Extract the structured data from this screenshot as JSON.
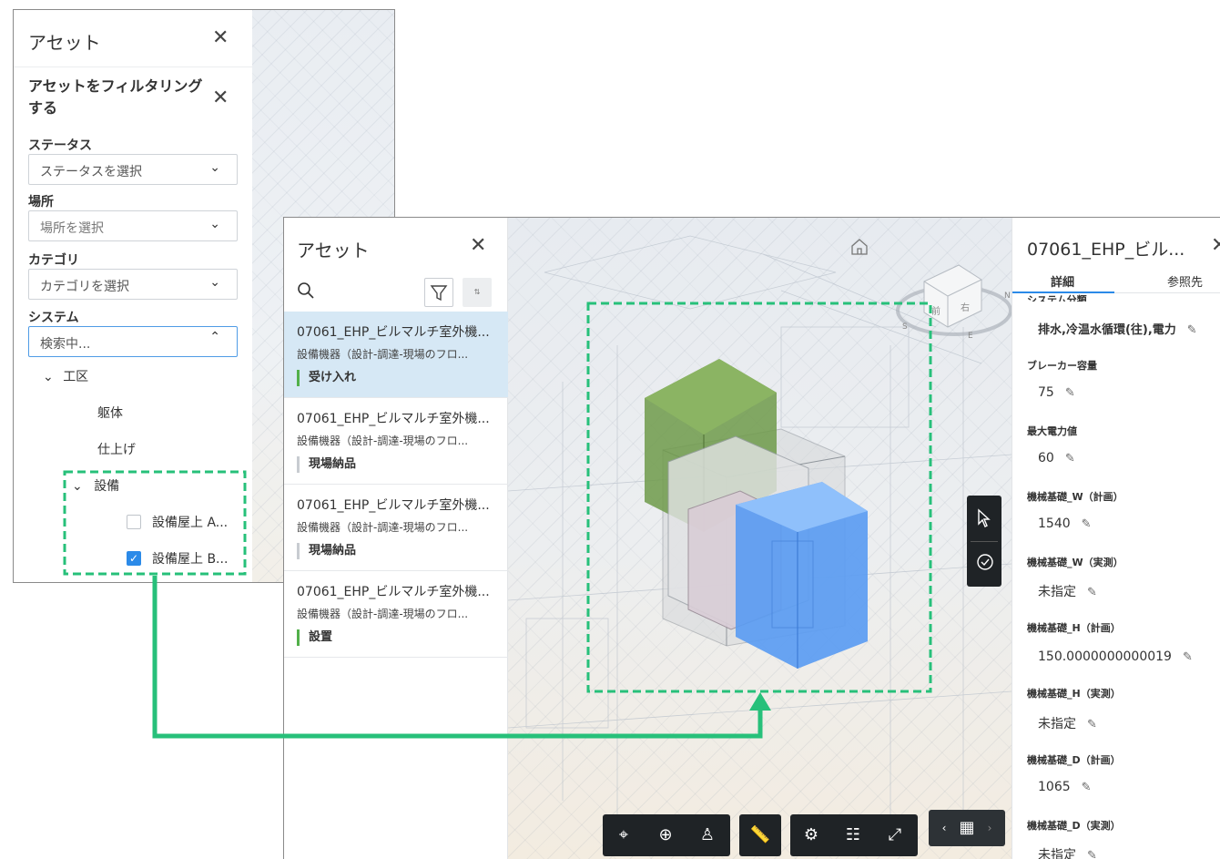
{
  "filter_panel": {
    "title": "アセット",
    "subpanel_title": "アセットをフィルタリングする",
    "status_label": "ステータス",
    "status_placeholder": "ステータスを選択",
    "location_label": "場所",
    "location_placeholder": "場所を選択",
    "category_label": "カテゴリ",
    "category_placeholder": "カテゴリを選択",
    "system_label": "システム",
    "system_search": "検索中...",
    "tree": {
      "root": "工区",
      "items": [
        "躯体",
        "仕上げ"
      ],
      "group": "設備",
      "children": [
        {
          "label": "設備屋上 A...",
          "checked": false
        },
        {
          "label": "設備屋上 B...",
          "checked": true
        }
      ]
    }
  },
  "asset_panel": {
    "title": "アセット",
    "items": [
      {
        "name": "07061_EHP_ビルマルチ室外機...",
        "sub": "設備機器（設計-調達-現場のフロ...",
        "status": "受け入れ",
        "status_color": "#52b04a",
        "selected": true
      },
      {
        "name": "07061_EHP_ビルマルチ室外機...",
        "sub": "設備機器（設計-調達-現場のフロ...",
        "status": "現場納品",
        "status_color": "#c8ccd1",
        "selected": false
      },
      {
        "name": "07061_EHP_ビルマルチ室外機...",
        "sub": "設備機器（設計-調達-現場のフロ...",
        "status": "現場納品",
        "status_color": "#c8ccd1",
        "selected": false
      },
      {
        "name": "07061_EHP_ビルマルチ室外機...",
        "sub": "設備機器（設計-調達-現場のフロ...",
        "status": "設置",
        "status_color": "#52b04a",
        "selected": false
      }
    ]
  },
  "viewcube": {
    "front": "前",
    "right": "右",
    "compass": [
      "S",
      "E",
      "N"
    ]
  },
  "props_panel": {
    "title": "07061_EHP_ビル...",
    "tab_details": "詳細",
    "tab_refs": "参照先",
    "cut_label": "システム分類",
    "system_value": "排水,冷温水循環(往),電力",
    "fields": [
      {
        "label": "ブレーカー容量",
        "value": "75"
      },
      {
        "label": "最大電力値",
        "value": "60"
      },
      {
        "label": "機械基礎_W（計画）",
        "value": "1540"
      },
      {
        "label": "機械基礎_W（実測）",
        "value": "未指定"
      },
      {
        "label": "機械基礎_H（計画）",
        "value": "150.0000000000019"
      },
      {
        "label": "機械基礎_H（実測）",
        "value": "未指定"
      },
      {
        "label": "機械基礎_D（計画）",
        "value": "1065"
      },
      {
        "label": "機械基礎_D（実測）",
        "value": "未指定"
      }
    ]
  },
  "colors": {
    "highlight": "#27c07a",
    "selection_blue": "#d6e8f5",
    "accent": "#2b8ae8"
  }
}
